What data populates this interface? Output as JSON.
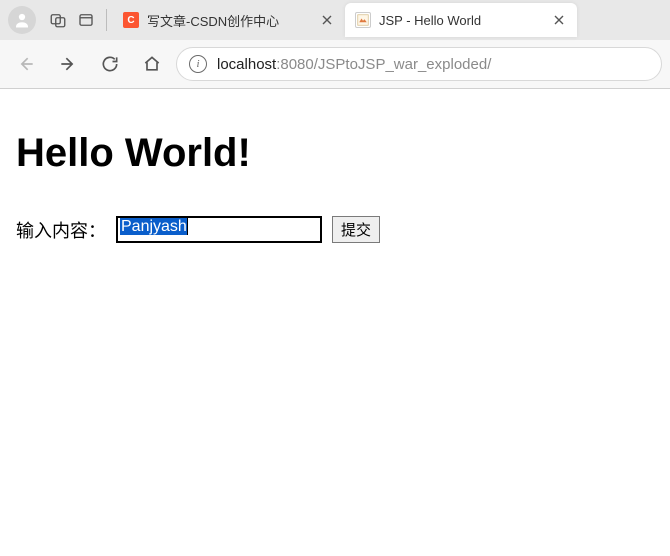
{
  "chrome": {
    "tabs": [
      {
        "title": "写文章-CSDN创作中心",
        "active": false,
        "favicon": "csdn"
      },
      {
        "title": "JSP - Hello World",
        "active": true,
        "favicon": "jsp"
      }
    ],
    "address": {
      "host": "localhost",
      "port": ":8080",
      "path": "/JSPtoJSP_war_exploded/"
    }
  },
  "page": {
    "heading": "Hello World!",
    "form": {
      "label": "输入内容：",
      "input_value": "Panjyash",
      "submit_label": "提交"
    }
  }
}
